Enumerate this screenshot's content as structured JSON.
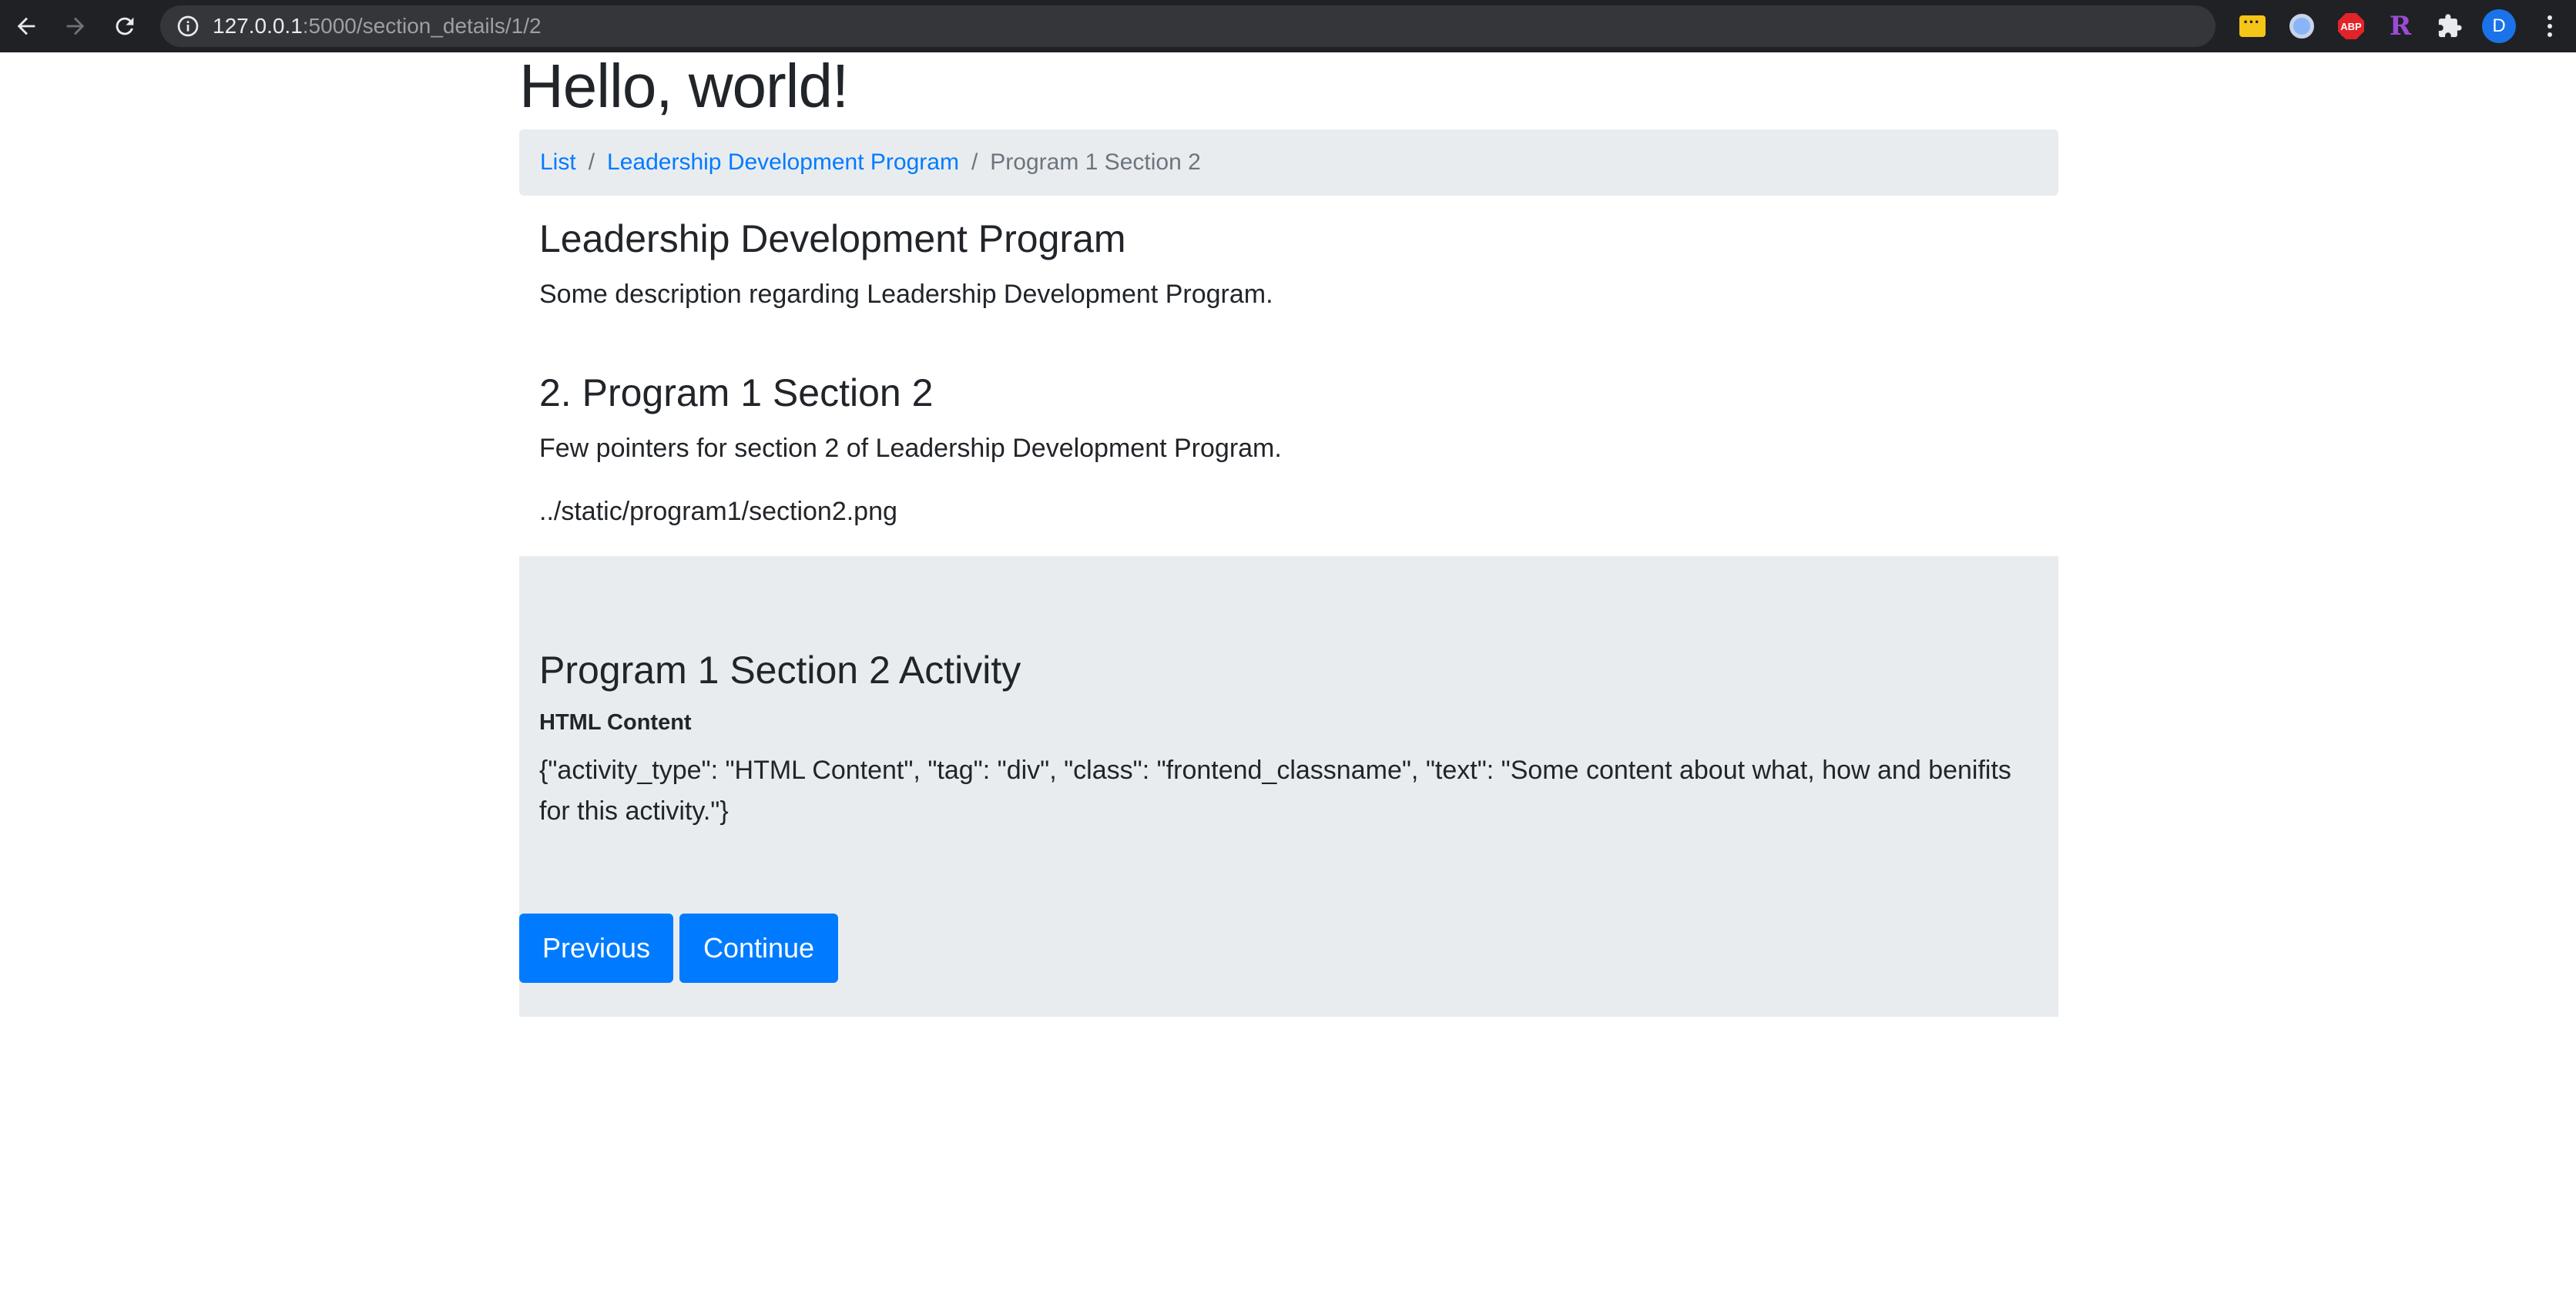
{
  "browser": {
    "url_host": "127.0.0.1",
    "url_path": ":5000/section_details/1/2",
    "avatar_initial": "D",
    "extensions": {
      "abp_label": "ABP",
      "r_label": "R"
    }
  },
  "page": {
    "title": "Hello, world!"
  },
  "breadcrumb": {
    "items": [
      {
        "label": "List"
      },
      {
        "label": "Leadership Development Program"
      },
      {
        "label": "Program 1 Section 2"
      }
    ],
    "separator": "/"
  },
  "program": {
    "title": "Leadership Development Program",
    "description": "Some description regarding Leadership Development Program."
  },
  "section": {
    "title": "2. Program 1 Section 2",
    "description": "Few pointers for section 2 of Leadership Development Program.",
    "image_path": "../static/program1/section2.png"
  },
  "activity": {
    "title": "Program 1 Section 2 Activity",
    "type_label": "HTML Content",
    "content": "{\"activity_type\": \"HTML Content\", \"tag\": \"div\", \"class\": \"frontend_classname\", \"text\": \"Some content about what, how and benifits for this activity.\"}",
    "previous_label": "Previous",
    "continue_label": "Continue"
  },
  "colors": {
    "primary": "#007bff",
    "muted_bg": "#e9ecef",
    "chrome_bg": "#202124"
  }
}
